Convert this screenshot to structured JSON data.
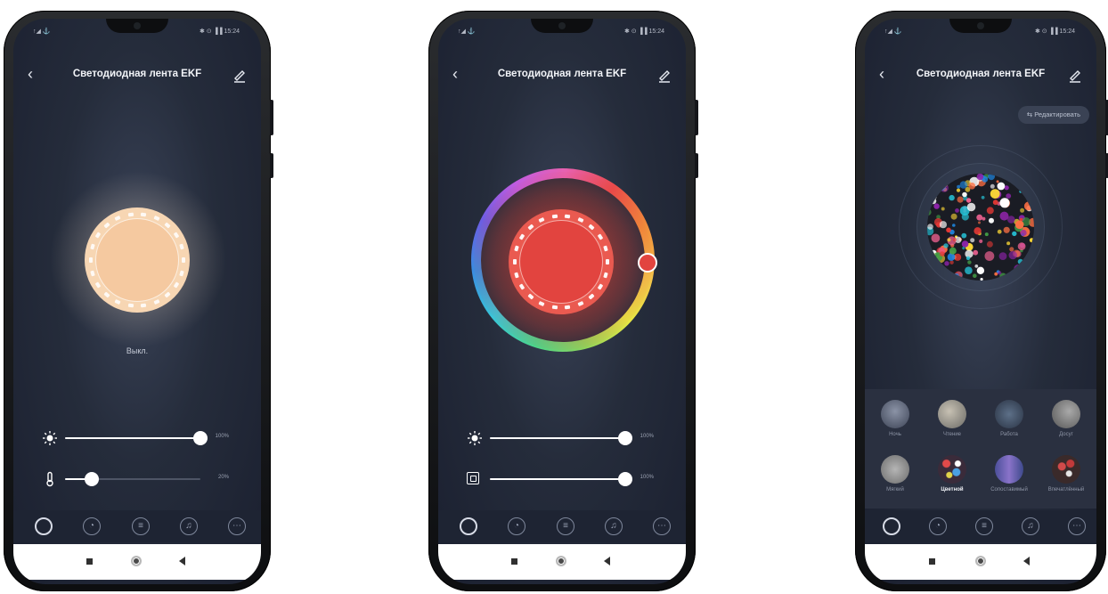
{
  "status_bar": {
    "left": "↑◢ ⚓",
    "right": "✱ ⊙ ▐▐ 15:24"
  },
  "device_title": "Светодиодная лента EKF",
  "screen1": {
    "state_label": "Выкл.",
    "brightness": {
      "value_text": "100%",
      "level": 1.0
    },
    "temperature": {
      "value_text": "20%",
      "level": 0.2
    },
    "bulb_color": "#f5c9a0"
  },
  "screen2": {
    "brightness": {
      "value_text": "100%",
      "level": 1.0
    },
    "saturation": {
      "value_text": "100%",
      "level": 1.0
    },
    "selected_color": "#e2443f"
  },
  "screen3": {
    "edit_button": "Редактировать",
    "scenes": [
      {
        "label": "Ночь",
        "selected": false
      },
      {
        "label": "Чтение",
        "selected": false
      },
      {
        "label": "Работа",
        "selected": false
      },
      {
        "label": "Досуг",
        "selected": false
      },
      {
        "label": "Мягкий",
        "selected": false
      },
      {
        "label": "Цветной",
        "selected": true
      },
      {
        "label": "Сопоставимый",
        "selected": false
      },
      {
        "label": "Впечатлённый",
        "selected": false
      }
    ]
  },
  "tabs": [
    "power-icon",
    "palette-icon",
    "scene-icon",
    "music-icon",
    "more-icon"
  ],
  "nav": [
    "recents-button",
    "home-button",
    "back-button"
  ]
}
